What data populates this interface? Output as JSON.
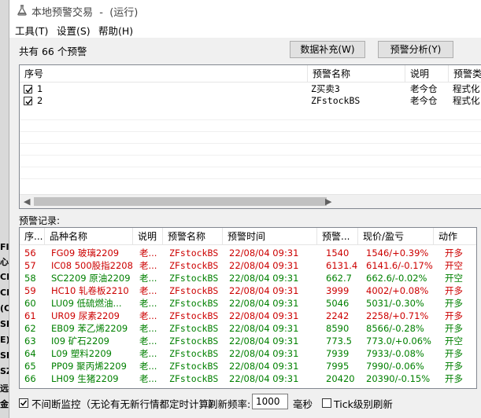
{
  "desktop": {
    "edge_labels": [
      "FI",
      "心",
      "CE",
      "CI",
      "(C",
      "SH",
      "E)",
      "SH",
      "SZ",
      "远",
      "金"
    ]
  },
  "window": {
    "title": "本地预警交易  -  (运行)",
    "menu": [
      "工具(T)",
      "设置(S)",
      "帮助(H)"
    ]
  },
  "header": {
    "count_text": "共有 66 个预警",
    "btn_supplement": "数据补充(W)",
    "btn_analysis": "预警分析(Y)"
  },
  "alert_list": {
    "columns": [
      "序号",
      "预警名称",
      "说明",
      "预警类"
    ],
    "rows": [
      {
        "checked": true,
        "seq": "1",
        "name": "Z买卖3",
        "desc": "老今仓",
        "type": "程式化"
      },
      {
        "checked": true,
        "seq": "2",
        "name": "ZFstockBS",
        "desc": "老今仓",
        "type": "程式化"
      }
    ]
  },
  "logs": {
    "label": "预警记录:",
    "columns": [
      "序...",
      "品种名称",
      "说明",
      "预警名称",
      "预警时间",
      "预警...",
      "现价/盈亏",
      "动作"
    ],
    "rows": [
      {
        "seq": "56",
        "product": "FG09 玻璃2209",
        "desc": "老...",
        "alert": "ZFstockBS",
        "time": "22/08/04 09:31",
        "price": "1540",
        "pnl": "1546/+0.39%",
        "action": "开多",
        "color": "red"
      },
      {
        "seq": "57",
        "product": "IC08 500股指2208",
        "desc": "老...",
        "alert": "ZFstockBS",
        "time": "22/08/04 09:31",
        "price": "6131.4",
        "pnl": "6141.6/-0.17%",
        "action": "开空",
        "color": "red"
      },
      {
        "seq": "58",
        "product": "SC2209 原油2209",
        "desc": "老...",
        "alert": "ZFstockBS",
        "time": "22/08/04 09:31",
        "price": "662.7",
        "pnl": "662.6/-0.02%",
        "action": "开空",
        "color": "green"
      },
      {
        "seq": "59",
        "product": "HC10 轧卷板2210",
        "desc": "老...",
        "alert": "ZFstockBS",
        "time": "22/08/04 09:31",
        "price": "3999",
        "pnl": "4002/+0.08%",
        "action": "开多",
        "color": "red"
      },
      {
        "seq": "60",
        "product": "LU09 低硫燃油...",
        "desc": "老...",
        "alert": "ZFstockBS",
        "time": "22/08/04 09:31",
        "price": "5046",
        "pnl": "5031/-0.30%",
        "action": "开多",
        "color": "green"
      },
      {
        "seq": "61",
        "product": "UR09 尿素2209",
        "desc": "老...",
        "alert": "ZFstockBS",
        "time": "22/08/04 09:31",
        "price": "2242",
        "pnl": "2258/+0.71%",
        "action": "开多",
        "color": "red"
      },
      {
        "seq": "62",
        "product": "EB09 苯乙烯2209",
        "desc": "老...",
        "alert": "ZFstockBS",
        "time": "22/08/04 09:31",
        "price": "8590",
        "pnl": "8566/-0.28%",
        "action": "开多",
        "color": "green"
      },
      {
        "seq": "63",
        "product": "I09 矿石2209",
        "desc": "老...",
        "alert": "ZFstockBS",
        "time": "22/08/04 09:31",
        "price": "773.5",
        "pnl": "773.0/+0.06%",
        "action": "开空",
        "color": "green"
      },
      {
        "seq": "64",
        "product": "L09 塑料2209",
        "desc": "老...",
        "alert": "ZFstockBS",
        "time": "22/08/04 09:31",
        "price": "7939",
        "pnl": "7933/-0.08%",
        "action": "开多",
        "color": "green"
      },
      {
        "seq": "65",
        "product": "PP09 聚丙烯2209",
        "desc": "老...",
        "alert": "ZFstockBS",
        "time": "22/08/04 09:31",
        "price": "7995",
        "pnl": "7990/-0.06%",
        "action": "开多",
        "color": "green"
      },
      {
        "seq": "66",
        "product": "LH09 生猪2209",
        "desc": "老...",
        "alert": "ZFstockBS",
        "time": "22/08/04 09:31",
        "price": "20420",
        "pnl": "20390/-0.15%",
        "action": "开多",
        "color": "green"
      }
    ]
  },
  "footer": {
    "continuous_label": "不间断监控（无论有无新行情都定时计算）",
    "continuous_checked": true,
    "refresh_label": "刷新频率:",
    "refresh_value": "1000",
    "unit": "毫秒",
    "tick_label": "Tick级别刷新",
    "tick_checked": false
  },
  "colors": {
    "up": "#cc0000",
    "down": "#008000",
    "window_bg": "#f0f0f0"
  }
}
